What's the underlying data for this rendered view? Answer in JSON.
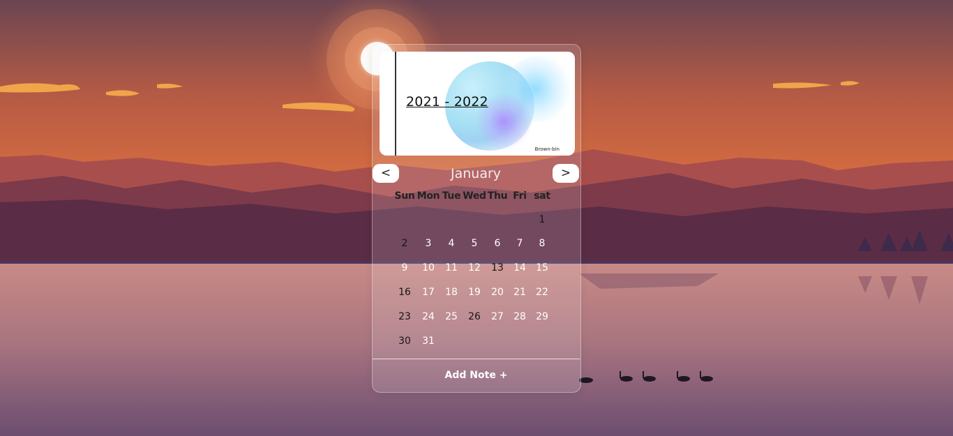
{
  "banner": {
    "year_range": "2021 - 2022",
    "credit": "Brown-bin"
  },
  "calendar": {
    "month": "January",
    "prev_label": "<",
    "next_label": ">",
    "weekdays": [
      "Sun",
      "Mon",
      "Tue",
      "Wed",
      "Thu",
      "Fri",
      "sat"
    ],
    "first_weekday_index": 6,
    "days_in_month": 31,
    "dark_days": [
      1,
      2,
      13,
      16,
      23,
      26,
      30
    ]
  },
  "add_note_label": "Add Note +",
  "colors": {
    "sky_top": "#6c4752",
    "sunset_orange": "#e07a3e",
    "mountain": "#7d3a4a",
    "water": "#c2858a",
    "text_white": "#ffffff"
  },
  "icons": {
    "prev": "chevron-left-icon",
    "next": "chevron-right-icon"
  }
}
